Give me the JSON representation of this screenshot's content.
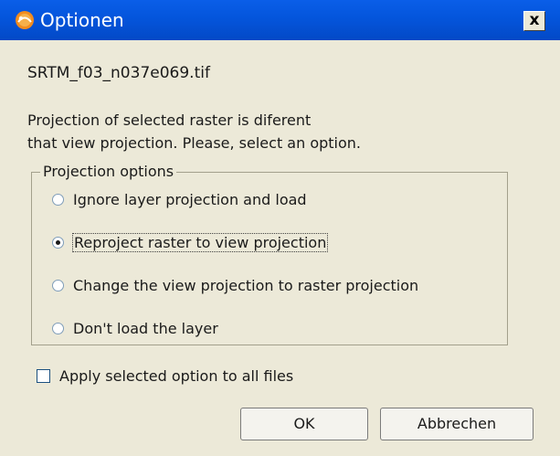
{
  "window": {
    "title": "Optionen",
    "close_glyph": "x",
    "icon": "app-logo-icon"
  },
  "file": {
    "name": "SRTM_f03_n037e069.tif"
  },
  "message": {
    "line1": "Projection of selected raster is diferent",
    "line2": "that view projection. Please, select an option."
  },
  "projection_group": {
    "legend": "Projection options",
    "options": [
      {
        "label": "Ignore layer projection and load",
        "checked": false
      },
      {
        "label": "Reproject raster to view projection",
        "checked": true
      },
      {
        "label": "Change the view projection to raster projection",
        "checked": false
      },
      {
        "label": "Don't load the layer",
        "checked": false
      }
    ]
  },
  "apply_all": {
    "label": "Apply selected option to all files",
    "checked": false
  },
  "buttons": {
    "ok": "OK",
    "cancel": "Abbrechen"
  },
  "colors": {
    "titlebar": "#0455dc",
    "dialog_bg": "#ece9d8"
  }
}
